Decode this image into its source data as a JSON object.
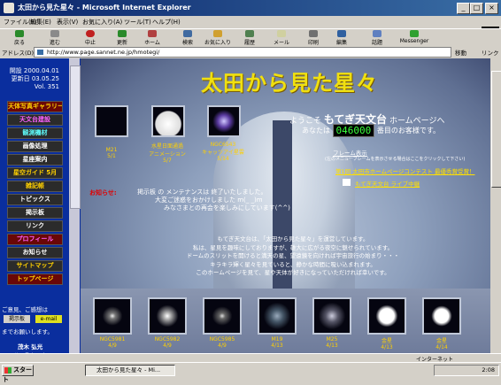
{
  "window": {
    "title": "太田から見た星々 - Microsoft Internet Explorer",
    "minimize": "_",
    "maximize": "□",
    "close": "×"
  },
  "menu": [
    "ファイル(F)",
    "編集(E)",
    "表示(V)",
    "お気に入り(A)",
    "ツール(T)",
    "ヘルプ(H)"
  ],
  "toolbar": {
    "back": "戻る",
    "forward": "進む",
    "stop": "中止",
    "refresh": "更新",
    "home": "ホーム",
    "search": "検索",
    "favorites": "お気に入り",
    "history": "履歴",
    "mail": "メール",
    "print": "印刷",
    "edit": "編集",
    "discuss": "話題",
    "messenger": "Messenger"
  },
  "address": {
    "label": "アドレス(D)",
    "url": "http://www.page.sannet.ne.jp/hmotegi/",
    "go": "移動",
    "links": "リンク"
  },
  "sidebar": {
    "opened": "開設 2000.04.01",
    "updated": "更新日 03.05.25",
    "volume": "Vol. 351",
    "items": [
      {
        "label": "天体写真ギャラリー",
        "color": "#ffd000"
      },
      {
        "label": "天文台建設",
        "color": "#ff60ff"
      },
      {
        "label": "観測機材",
        "color": "#60ffff"
      },
      {
        "label": "画像処理",
        "color": "#ffffff"
      },
      {
        "label": "星座案内",
        "color": "#ffffff"
      },
      {
        "label": "星空ガイド 5月",
        "color": "#ffd000"
      },
      {
        "label": "雑記帳",
        "color": "#ffd000"
      },
      {
        "label": "トピックス",
        "color": "#ffffff"
      },
      {
        "label": "掲示板",
        "color": "#ffffff"
      },
      {
        "label": "リンク",
        "color": "#ffffff"
      },
      {
        "label": "プロフィール",
        "color": "#ff60ff"
      },
      {
        "label": "お知らせ",
        "color": "#ffffff"
      },
      {
        "label": "サイトマップ",
        "color": "#ffd000"
      },
      {
        "label": "トップページ",
        "color": "#ffd000"
      }
    ],
    "contact_note": "ご意見、ご感想は",
    "board_chip": "掲示板",
    "email_chip": "e-mail",
    "contact_note2": "までお願いします。",
    "author": "茂木 弘光",
    "location": "群馬県太田市"
  },
  "main": {
    "site_title": "太田から見た星々",
    "welcome_pre": "ようこそ",
    "observatory_name": "もてぎ天文台",
    "welcome_post": "ホームページへ",
    "visitor_pre": "あなたは",
    "visitor_count": "046000",
    "visitor_post": "番目のお客様です。",
    "frame_link": "フレーム表示",
    "frame_note": "(左のメニューフレームを表示させる場合はここをクリックして下さい)",
    "award_link": "第1回 太田市ホームページコンテスト 最優秀賞受賞！",
    "live_link": "もてぎ天文台 ライブ中継",
    "notice_label": "お知らせ:",
    "notice_lines": [
      "掲示板 の メンテナンスは 終了いたしました。",
      "大変ご迷惑をおかけしました m(_ _)m",
      "みなさまとの再会を楽しみにしています(^^)"
    ],
    "message_lines": [
      "もてぎ天文台は、「太田から見た星々」を運営しています。",
      "私は、星見を趣味にしておりますが、雄大に広がる夜空に魅せられています。",
      "ドームのスリットを開けると満天の星、望遠鏡を向ければ宇宙旅行の始まり・・・",
      "キラキラ輝く星々を見ていると、静かな時間に吸い込まれます。",
      "このホームページを見て、星や天体が好きになっていただければ幸いです。"
    ],
    "top_thumbs": [
      {
        "name": "M21",
        "date": "5/1"
      },
      {
        "name": "水星日面通過",
        "sub": "アニメーション",
        "date": "5/7"
      },
      {
        "name": "NGC6543",
        "sub": "キャッツアイ星雲",
        "date": "5/14"
      }
    ],
    "bottom_thumbs": [
      {
        "name": "NGC5981",
        "date": "4/9"
      },
      {
        "name": "NGC5982",
        "date": "4/9"
      },
      {
        "name": "NGC5985",
        "date": "4/9"
      },
      {
        "name": "M19",
        "date": "4/13"
      },
      {
        "name": "M25",
        "date": "4/13"
      },
      {
        "name": "金星",
        "date": "4/13"
      },
      {
        "name": "金星",
        "date": "4/14"
      }
    ]
  },
  "status": {
    "zone": "インターネット"
  },
  "taskbar": {
    "start": "スタート",
    "task": "太田から見た星々 - Mi...",
    "clock": "2:08"
  }
}
